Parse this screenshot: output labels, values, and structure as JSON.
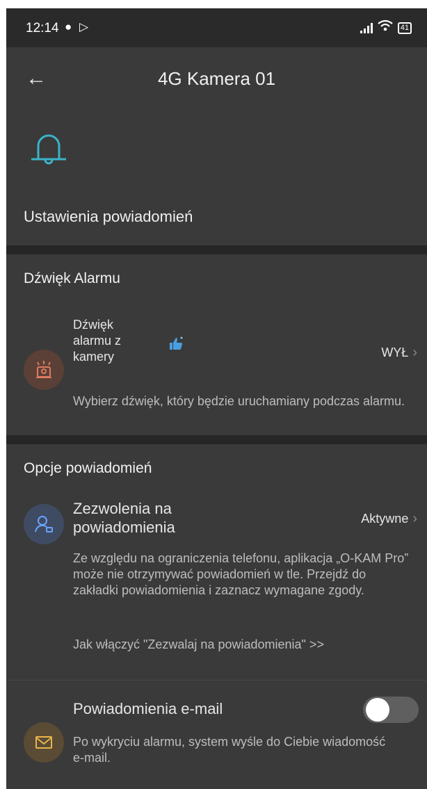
{
  "status_bar": {
    "time": "12:14",
    "battery": "41"
  },
  "app_bar": {
    "title": "4G Kamera 01"
  },
  "hero": {
    "icon": "bell-icon",
    "title": "Ustawienia powiadomień"
  },
  "alarm_section": {
    "header": "Dźwięk Alarmu",
    "item": {
      "title_line1": "Dźwięk",
      "title_line2": "alarmu z",
      "title_line3": "kamery",
      "badge_icon": "thumbs-up-icon",
      "value": "WYŁ",
      "description": "Wybierz dźwięk, który będzie uruchamiany podczas alarmu."
    }
  },
  "notifications_section": {
    "header": "Opcje powiadomień",
    "permissions": {
      "title_line1": "Zezwolenia na",
      "title_line2": "powiadomienia",
      "value": "Aktywne",
      "description": "Ze względu na ograniczenia telefonu, aplikacja „O-KAM Pro” może nie otrzymywać powiadomień w tle. Przejdź do zakładki powiadomienia i zaznacz wymagane zgody.",
      "link": "Jak włączyć \"Zezwalaj na powiadomienia\" >>"
    },
    "email": {
      "title": "Powiadomienia e-mail",
      "description": "Po wykryciu alarmu, system wyśle do Ciebie wiadomość e-mail.",
      "enabled": false
    }
  },
  "colors": {
    "background": "#3a3a3a",
    "accent_bell": "#3bb3c9",
    "divider": "#262626"
  }
}
